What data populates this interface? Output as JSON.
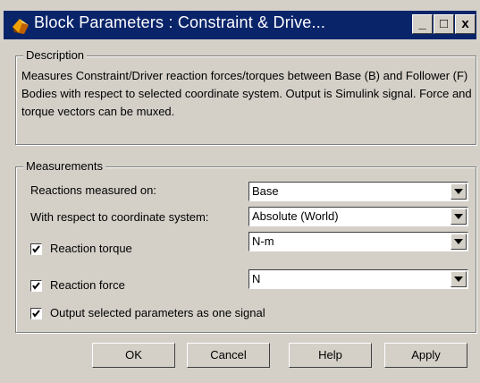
{
  "window": {
    "title": "Block Parameters : Constraint & Drive...",
    "controls": {
      "minimize": "_",
      "maximize": "□",
      "close": "x"
    }
  },
  "description": {
    "legend": "Description",
    "text": "Measures Constraint/Driver reaction forces/torques between Base (B) and Follower (F) Bodies with respect to selected coordinate system. Output is Simulink signal. Force and torque vectors can be muxed."
  },
  "measurements": {
    "legend": "Measurements",
    "reactions_label": "Reactions measured on:",
    "reactions_value": "Base",
    "coord_label": "With respect to coordinate system:",
    "coord_value": "Absolute (World)",
    "torque_label": "Reaction torque",
    "torque_checked": true,
    "torque_units": "N-m",
    "force_label": "Reaction force",
    "force_checked": true,
    "force_units": "N",
    "one_signal_label": "Output selected parameters as one signal",
    "one_signal_checked": true
  },
  "buttons": {
    "ok": "OK",
    "cancel": "Cancel",
    "help": "Help",
    "apply": "Apply"
  },
  "icons": {
    "title": "simmechanics-block-icon",
    "dropdown": "chevron-down-icon",
    "check": "check-icon"
  },
  "colors": {
    "titlebar": "#0a246a",
    "face": "#d4d0c8",
    "title_text": "#ffffff"
  }
}
